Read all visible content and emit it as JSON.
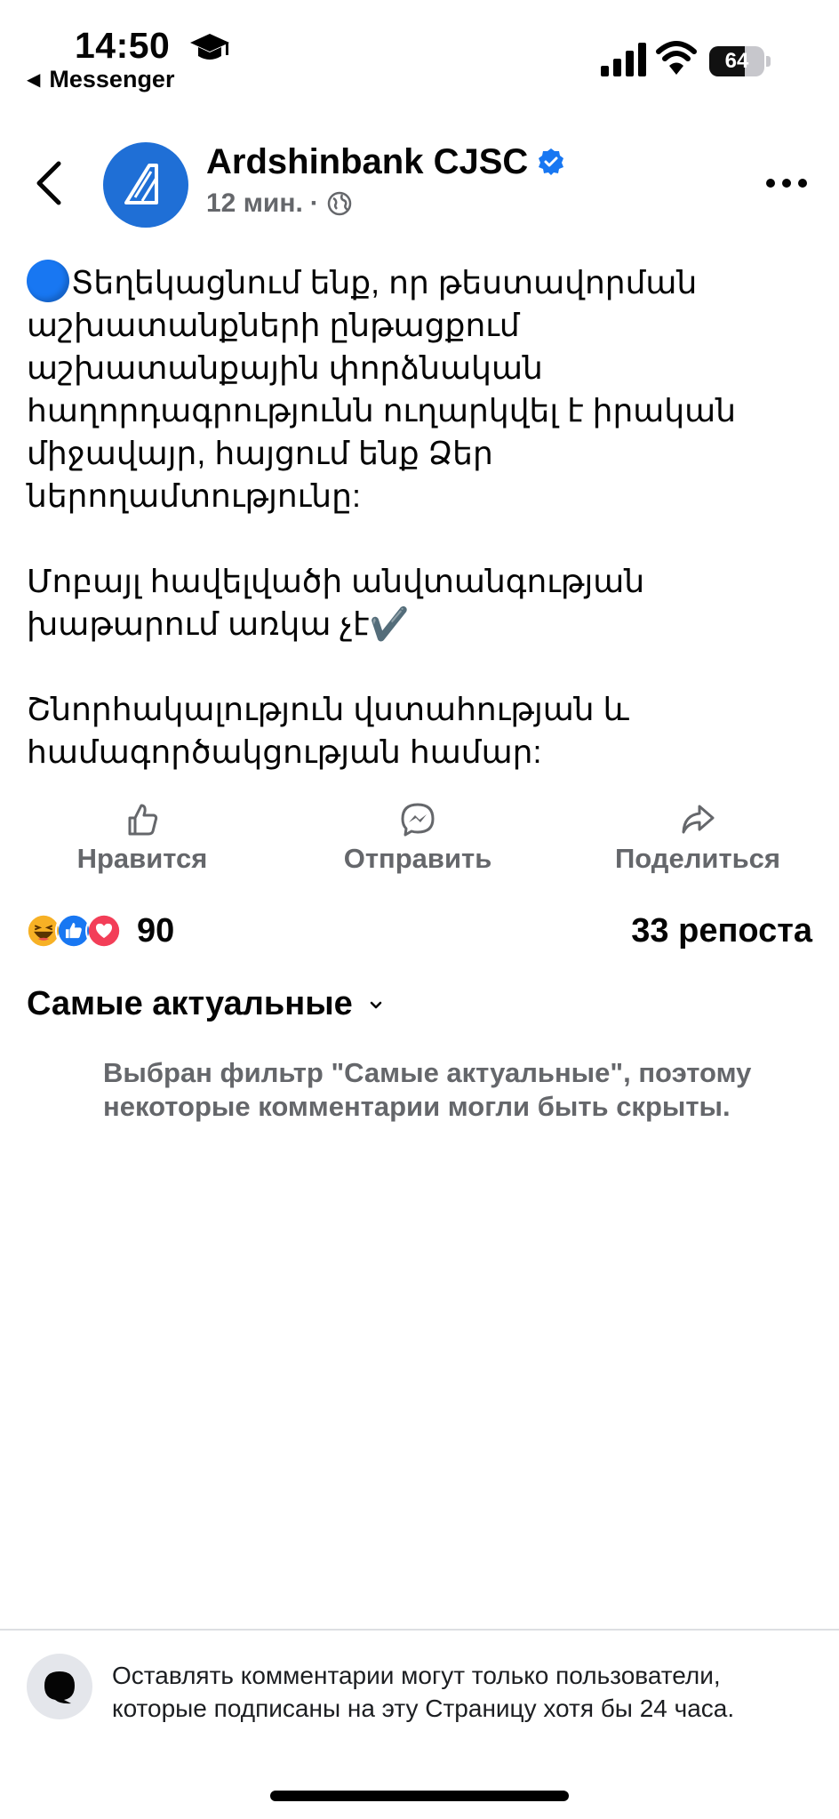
{
  "status_bar": {
    "time": "14:50",
    "back_app_label": "Messenger",
    "battery_percent": 64
  },
  "header": {
    "page_name": "Ardshinbank CJSC",
    "time_ago": "12 мин.",
    "separator": "·"
  },
  "post": {
    "paragraphs": [
      "Տեղեկացնում ենք, որ թեստավորման աշխատանքների ընթացքում աշխատանքային փորձնական հաղորդագրությունն ուղարկվել է իրական միջավայր, հայցում ենք Ձեր ներողամտությունը:",
      "Մոբայլ հավելվածի անվտանգության խաթարում առկա չէ✔️",
      "Շնորհակալություն վստահության և համագործակցության համար:"
    ]
  },
  "actions": {
    "like_label": "Нравится",
    "send_label": "Отправить",
    "share_label": "Поделиться"
  },
  "stats": {
    "reactions_count": "90",
    "reposts": "33 репоста"
  },
  "comments": {
    "filter_label": "Самые актуальные",
    "filter_notice": "Выбран фильтр \"Самые актуальные\", поэтому некоторые комментарии могли быть скрыты."
  },
  "footer": {
    "restriction_text": "Оставлять комментарии могут только пользователи, которые подписаны на эту Страницу хотя бы 24 часа."
  },
  "colors": {
    "brand_blue": "#1877f2",
    "avatar_blue": "#1f6fd6",
    "secondary_text": "#65676b"
  }
}
